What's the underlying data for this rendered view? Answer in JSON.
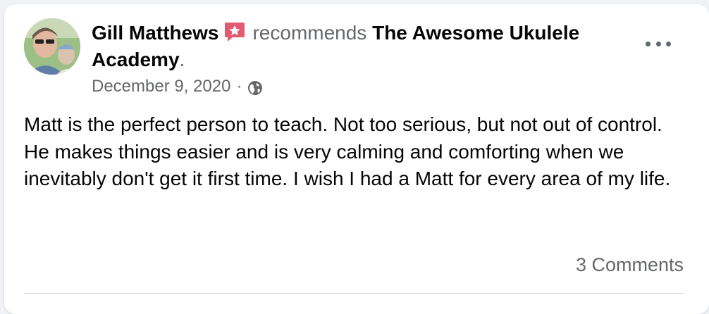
{
  "post": {
    "author": "Gill Matthews",
    "verb": "recommends",
    "page": "The Awesome Ukulele Academy",
    "period": ".",
    "date": "December 9, 2020",
    "separator": "·",
    "privacy_icon": "globe-icon",
    "badge_icon": "recommendation-star-icon",
    "text": "Matt is the perfect person to teach. Not too serious, but not out of control. He makes things easier and is very calming and comforting when we inevitably don't get it first time. I wish I had a Matt for every area of my life.",
    "comments": "3 Comments"
  },
  "colors": {
    "primary_text": "#050505",
    "secondary_text": "#65676b",
    "badge": "#e25b71",
    "card_bg": "#ffffff",
    "page_bg": "#f0f2f5"
  }
}
